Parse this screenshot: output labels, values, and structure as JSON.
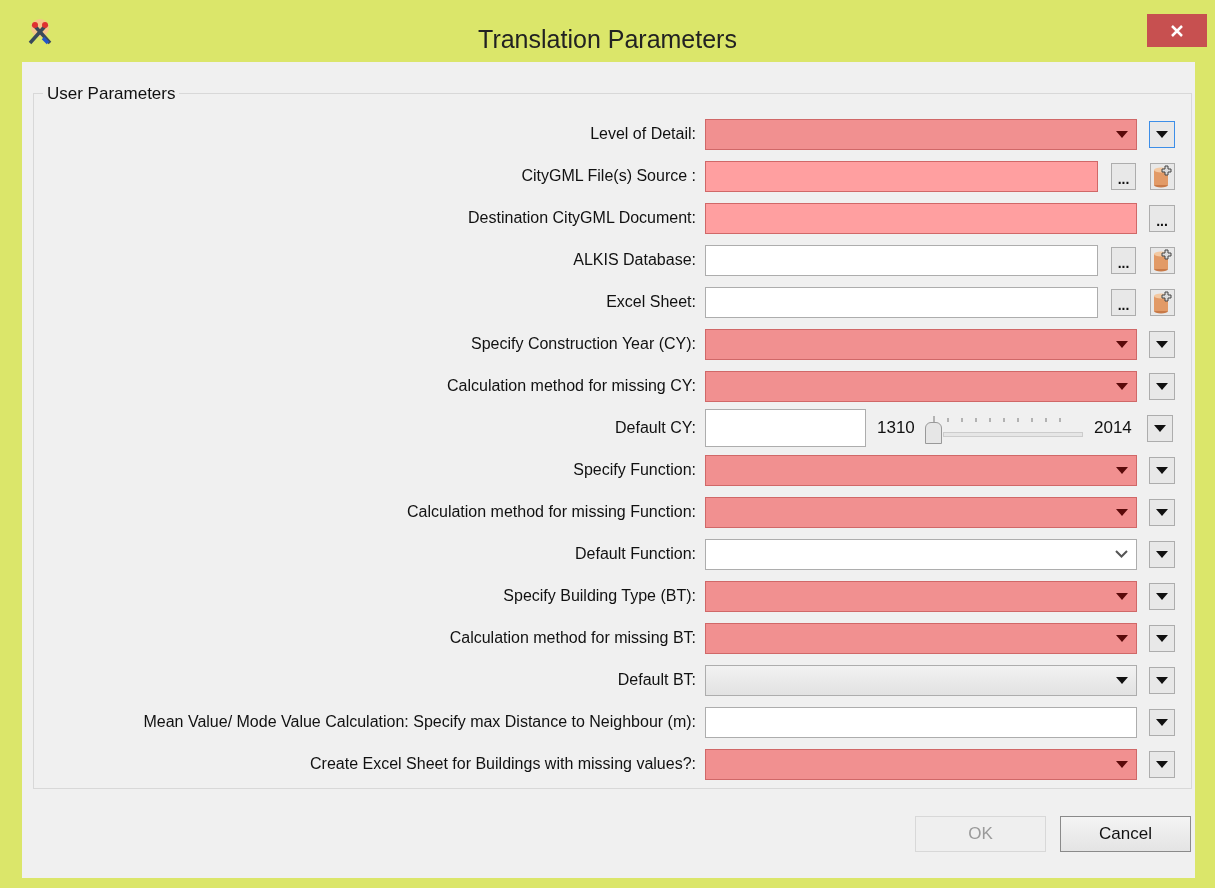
{
  "window": {
    "title": "Translation Parameters"
  },
  "group": {
    "title": "User Parameters"
  },
  "rows": [
    {
      "label": "Level of Detail:",
      "kind": "combo",
      "required": true,
      "menu_button": {
        "focused": true
      }
    },
    {
      "label": "CityGML File(s) Source :",
      "kind": "file",
      "required": true,
      "browse_button": "...",
      "add_button": true
    },
    {
      "label": "Destination CityGML Document:",
      "kind": "file",
      "required": true,
      "browse_button": "...",
      "add_button": false
    },
    {
      "label": "ALKIS Database:",
      "kind": "file",
      "required": false,
      "browse_button": "...",
      "add_button": true
    },
    {
      "label": "Excel Sheet:",
      "kind": "file",
      "required": false,
      "browse_button": "...",
      "add_button": true
    },
    {
      "label": "Specify Construction Year (CY):",
      "kind": "combo",
      "required": true,
      "menu_button": {
        "focused": false
      }
    },
    {
      "label": "Calculation method for missing CY:",
      "kind": "combo",
      "required": true,
      "menu_button": {
        "focused": false
      }
    },
    {
      "label": "Default CY:",
      "kind": "slider",
      "min": "1310",
      "max": "2014",
      "level": 0,
      "menu_button": {
        "focused": false
      }
    },
    {
      "label": "Specify Function:",
      "kind": "combo",
      "required": true,
      "menu_button": {
        "focused": false
      }
    },
    {
      "label": "Calculation method for missing Function:",
      "kind": "combo",
      "required": true,
      "menu_button": {
        "focused": false
      }
    },
    {
      "label": "Default Function:",
      "kind": "editable_combo",
      "required": false,
      "menu_button": {
        "focused": false
      }
    },
    {
      "label": "Specify Building Type (BT):",
      "kind": "combo",
      "required": true,
      "menu_button": {
        "focused": false
      }
    },
    {
      "label": "Calculation method for missing BT:",
      "kind": "combo",
      "required": true,
      "menu_button": {
        "focused": false
      }
    },
    {
      "label": "Default BT:",
      "kind": "combo",
      "required": false,
      "menu_button": {
        "focused": false
      }
    },
    {
      "label": "Mean Value/ Mode Value Calculation: Specify max Distance to Neighbour (m):",
      "kind": "text",
      "required": false,
      "menu_button": {
        "focused": false
      }
    },
    {
      "label": "Create Excel Sheet for Buildings with missing values?:",
      "kind": "combo",
      "required": true,
      "menu_button": {
        "focused": false
      }
    }
  ],
  "buttons": [
    {
      "label": "OK",
      "disabled": true
    },
    {
      "label": "Cancel",
      "disabled": false
    }
  ]
}
